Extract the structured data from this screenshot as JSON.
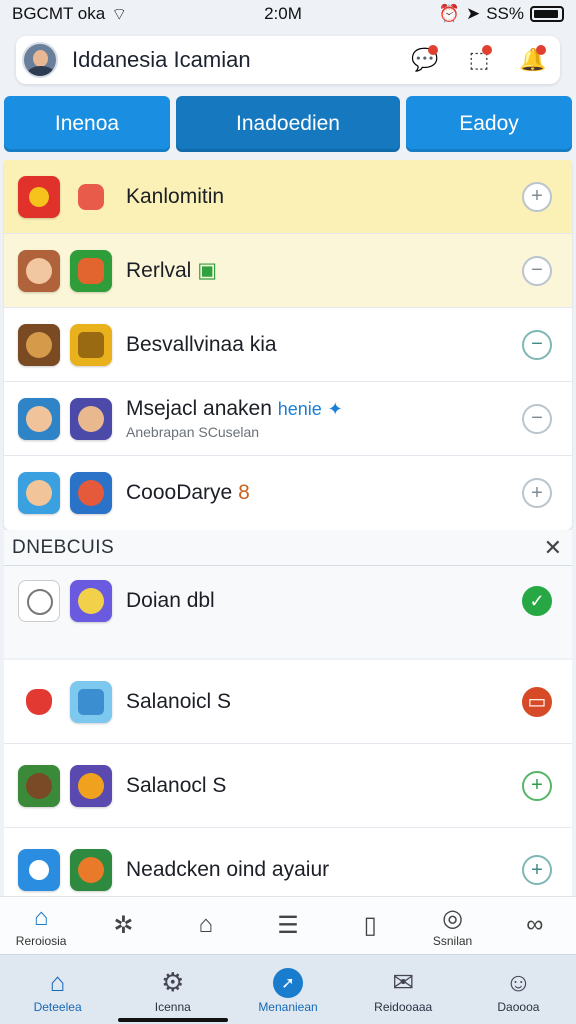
{
  "status": {
    "carrier": "BGCMT oka",
    "time": "2:0M",
    "battery": "SS%"
  },
  "header": {
    "title": "Iddanesia Icamian"
  },
  "tabs": [
    {
      "label": "Inenoa"
    },
    {
      "label": "Inadoedien"
    },
    {
      "label": "Eadoy"
    }
  ],
  "list": [
    {
      "title": "Kanlomitin",
      "subtitle": "",
      "action": "+"
    },
    {
      "title": "Rerlval",
      "subtitle": "",
      "action": "−"
    },
    {
      "title": "Besvallvinaa kia",
      "subtitle": "",
      "action": "−"
    },
    {
      "title": "Msejacl anaken",
      "accent": "henie",
      "subtitle": "Anebrapan SCuselan",
      "action": "−"
    },
    {
      "title": "CoooDarye",
      "subtitle": "",
      "action": "+"
    }
  ],
  "section": {
    "title": "DNEBCUIS",
    "row_title": "Doian dbl"
  },
  "list2": [
    {
      "title": "Salanoicl S",
      "action": "▭"
    },
    {
      "title": "Salanocl S",
      "action": "+"
    },
    {
      "title": "Neadcken oind ayaiur",
      "action": "+"
    }
  ],
  "toolbar": [
    {
      "label": "Reroiosia",
      "icon": "home-icon"
    },
    {
      "label": "",
      "icon": "puzzle-icon"
    },
    {
      "label": "",
      "icon": "bookmark-icon"
    },
    {
      "label": "",
      "icon": "list-icon"
    },
    {
      "label": "",
      "icon": "clipboard-icon"
    },
    {
      "label": "Ssnilan",
      "icon": "dial-icon"
    },
    {
      "label": "",
      "icon": "link-icon"
    }
  ],
  "bottom_nav": [
    {
      "label": "Deteelea",
      "icon": "home-icon"
    },
    {
      "label": "Icenna",
      "icon": "gear-icon"
    },
    {
      "label": "Menaniean",
      "icon": "compass-icon"
    },
    {
      "label": "Reidooaaa",
      "icon": "inbox-icon"
    },
    {
      "label": "Daoooa",
      "icon": "profile-icon"
    }
  ],
  "colors": {
    "accent": "#1a8ee0",
    "highlight": "#fbf1b6",
    "success": "#27a844",
    "danger": "#d74a28"
  }
}
